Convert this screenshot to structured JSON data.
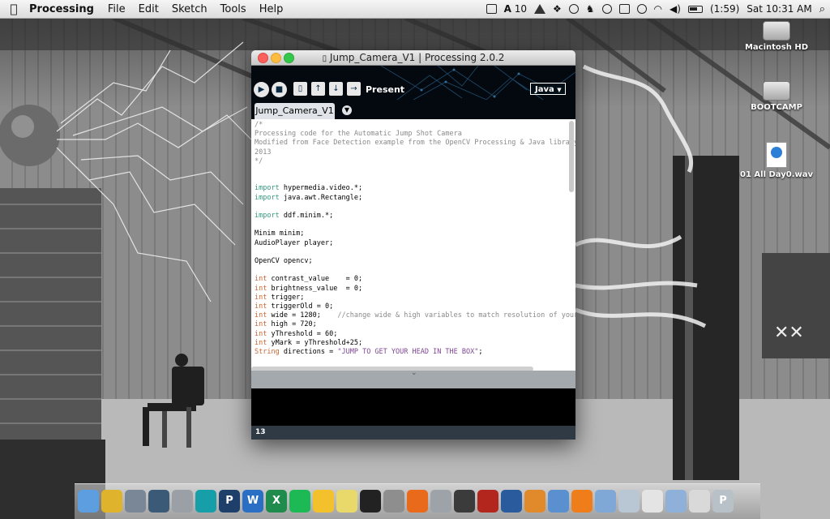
{
  "menubar": {
    "app_name": "Processing",
    "items": [
      "File",
      "Edit",
      "Sketch",
      "Tools",
      "Help"
    ],
    "status": {
      "adobe_count": "10",
      "battery": "(1:59)",
      "clock": "Sat 10:31 AM"
    }
  },
  "desktop_icons": [
    "Macintosh HD",
    "BOOTCAMP",
    "01 All Day0.wav"
  ],
  "window": {
    "title": "Jump_Camera_V1 | Processing 2.0.2",
    "toolbar": {
      "present_label": "Present",
      "mode": "Java"
    },
    "tab": "Jump_Camera_V1",
    "status_line": "13"
  },
  "code_lines": [
    {
      "t": "cmt",
      "text": "/*"
    },
    {
      "t": "cmt",
      "text": "Processing code for the Automatic Jump Shot Camera"
    },
    {
      "t": "cmt",
      "text": "Modified from Face Detection example from the OpenCV Processing & Java library"
    },
    {
      "t": "cmt",
      "text": "2013"
    },
    {
      "t": "cmt",
      "text": "*/"
    },
    {
      "t": "plain",
      "text": ""
    },
    {
      "t": "plain",
      "text": ""
    },
    {
      "t": "imp",
      "kw": "import",
      "text": " hypermedia.video.*;"
    },
    {
      "t": "imp",
      "kw": "import",
      "text": " java.awt.Rectangle;"
    },
    {
      "t": "plain",
      "text": ""
    },
    {
      "t": "imp",
      "kw": "import",
      "text": " ddf.minim.*;"
    },
    {
      "t": "plain",
      "text": ""
    },
    {
      "t": "plain",
      "text": "Minim minim;"
    },
    {
      "t": "plain",
      "text": "AudioPlayer player;"
    },
    {
      "t": "plain",
      "text": ""
    },
    {
      "t": "plain",
      "text": "OpenCV opencv;"
    },
    {
      "t": "plain",
      "text": ""
    },
    {
      "t": "kw",
      "kw": "int",
      "text": " contrast_value    = 0;"
    },
    {
      "t": "kw",
      "kw": "int",
      "text": " brightness_value  = 0;"
    },
    {
      "t": "kw",
      "kw": "int",
      "text": " trigger;"
    },
    {
      "t": "kw",
      "kw": "int",
      "text": " triggerOld = 0;"
    },
    {
      "t": "kw",
      "kw": "int",
      "text": " wide = 1280;    ",
      "cmt": "//change wide & high variables to match resolution of your w"
    },
    {
      "t": "kw",
      "kw": "int",
      "text": " high = 720;"
    },
    {
      "t": "kw",
      "kw": "int",
      "text": " yThreshold = 60;"
    },
    {
      "t": "kw",
      "kw": "int",
      "text": " yMark = yThreshold+25;"
    },
    {
      "t": "str",
      "kw": "String",
      "text": " directions = ",
      "str": "\"JUMP TO GET YOUR HEAD IN THE BOX\"",
      "tail": ";"
    }
  ],
  "dock": {
    "apps": [
      "finder-icon",
      "chrome-icon",
      "launchpad-icon",
      "photo-icon",
      "calculator-icon",
      "arduino-icon",
      "processing-icon",
      "word-icon",
      "excel-icon",
      "spotify-icon",
      "drive-icon",
      "stickies-icon",
      "terminal-icon",
      "system-prefs-icon",
      "firefox-icon",
      "disk-utility-icon",
      "activity-monitor-icon",
      "acrobat-icon",
      "virtualbox-icon",
      "ibooks-icon",
      "folder-icon",
      "vlc-icon",
      "downloads-icon",
      "documents-icon",
      "pdf-icon",
      "applications-icon",
      "preview-icon",
      "trash-icon"
    ],
    "colors": [
      "#5d9ee0",
      "#e0b32c",
      "#7a8796",
      "#3b5a78",
      "#9aa0a6",
      "#169fa8",
      "#1e3f6a",
      "#2b6fc4",
      "#1f8b4c",
      "#1db954",
      "#f3c12b",
      "#e9d86a",
      "#222222",
      "#8e8e8e",
      "#e86a1a",
      "#9da3a9",
      "#3b3b3b",
      "#b3261e",
      "#2a5b9c",
      "#e08a2c",
      "#5a8fd0",
      "#ee7d1a",
      "#7fa8d6",
      "#b9c6d4",
      "#e4e4e4",
      "#8fb1d9",
      "#d9d9d9",
      "#b8c0c8"
    ],
    "letters": [
      "",
      "",
      "",
      "",
      "",
      "",
      "P",
      "W",
      "X",
      "",
      "",
      "",
      "",
      "",
      "",
      "",
      "",
      "",
      "",
      "",
      "",
      "",
      "",
      "",
      "",
      "",
      "",
      "P"
    ]
  }
}
